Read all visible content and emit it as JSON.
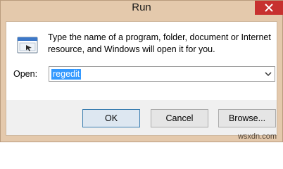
{
  "window": {
    "title": "Run",
    "close_icon": "close-icon"
  },
  "dialog": {
    "description": "Type the name of a program, folder, document or Internet resource, and Windows will open it for you.",
    "open_label": "Open:",
    "open_value": "regedit",
    "run_icon": "run-icon"
  },
  "buttons": {
    "ok": "OK",
    "cancel": "Cancel",
    "browse": "Browse..."
  },
  "watermark": "wsxdn.com",
  "colors": {
    "frame": "#e4c9ac",
    "selection": "#3399ff",
    "close_button": "#c7312f"
  }
}
